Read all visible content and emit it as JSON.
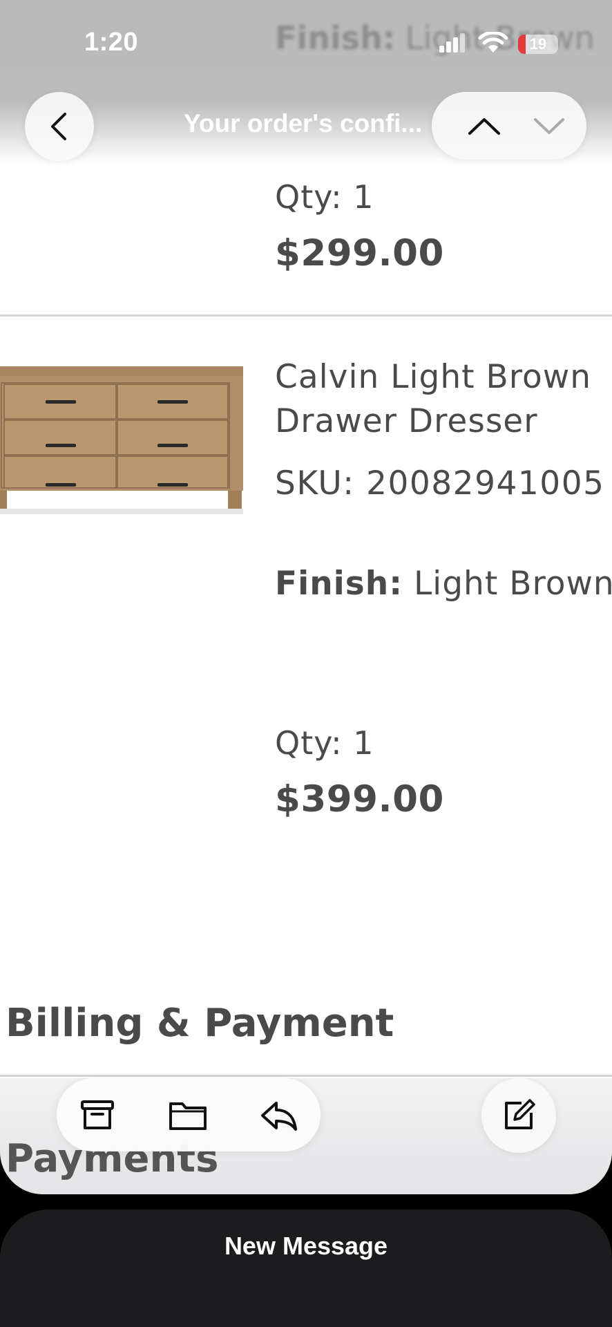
{
  "status_bar": {
    "time": "1:20",
    "battery_level": "19",
    "battery_fraction": 0.19,
    "signal_icon": "cellular-signal-icon",
    "wifi_icon": "wifi-icon"
  },
  "background_text": {
    "finish_label": "Finish:",
    "finish_value": " Light Brown"
  },
  "nav": {
    "title": "Your order's confi...",
    "back_icon": "chevron-left-icon",
    "prev_icon": "chevron-up-icon",
    "next_icon": "chevron-down-icon"
  },
  "items": [
    {
      "qty": "Qty: 1",
      "price": "$299.00"
    },
    {
      "name_line1": "Calvin Light Brown",
      "name_line2": "Drawer Dresser",
      "sku": "SKU: 20082941005",
      "finish_label": "Finish:",
      "finish_value": " Light Brown",
      "qty": "Qty: 1",
      "price": "$399.00",
      "image_icon": "dresser-image"
    }
  ],
  "sections": {
    "billing": "Billing & Payment",
    "payments": "Payments"
  },
  "toolbar": {
    "archive_icon": "archive-icon",
    "folder_icon": "folder-icon",
    "reply_icon": "reply-icon",
    "compose_icon": "compose-icon"
  },
  "bottom_sheet": {
    "label": "New Message"
  },
  "colors": {
    "text": "#4a4a4a",
    "bottom_sheet": "#1c1c1e",
    "battery_low": "#e33b3b"
  }
}
